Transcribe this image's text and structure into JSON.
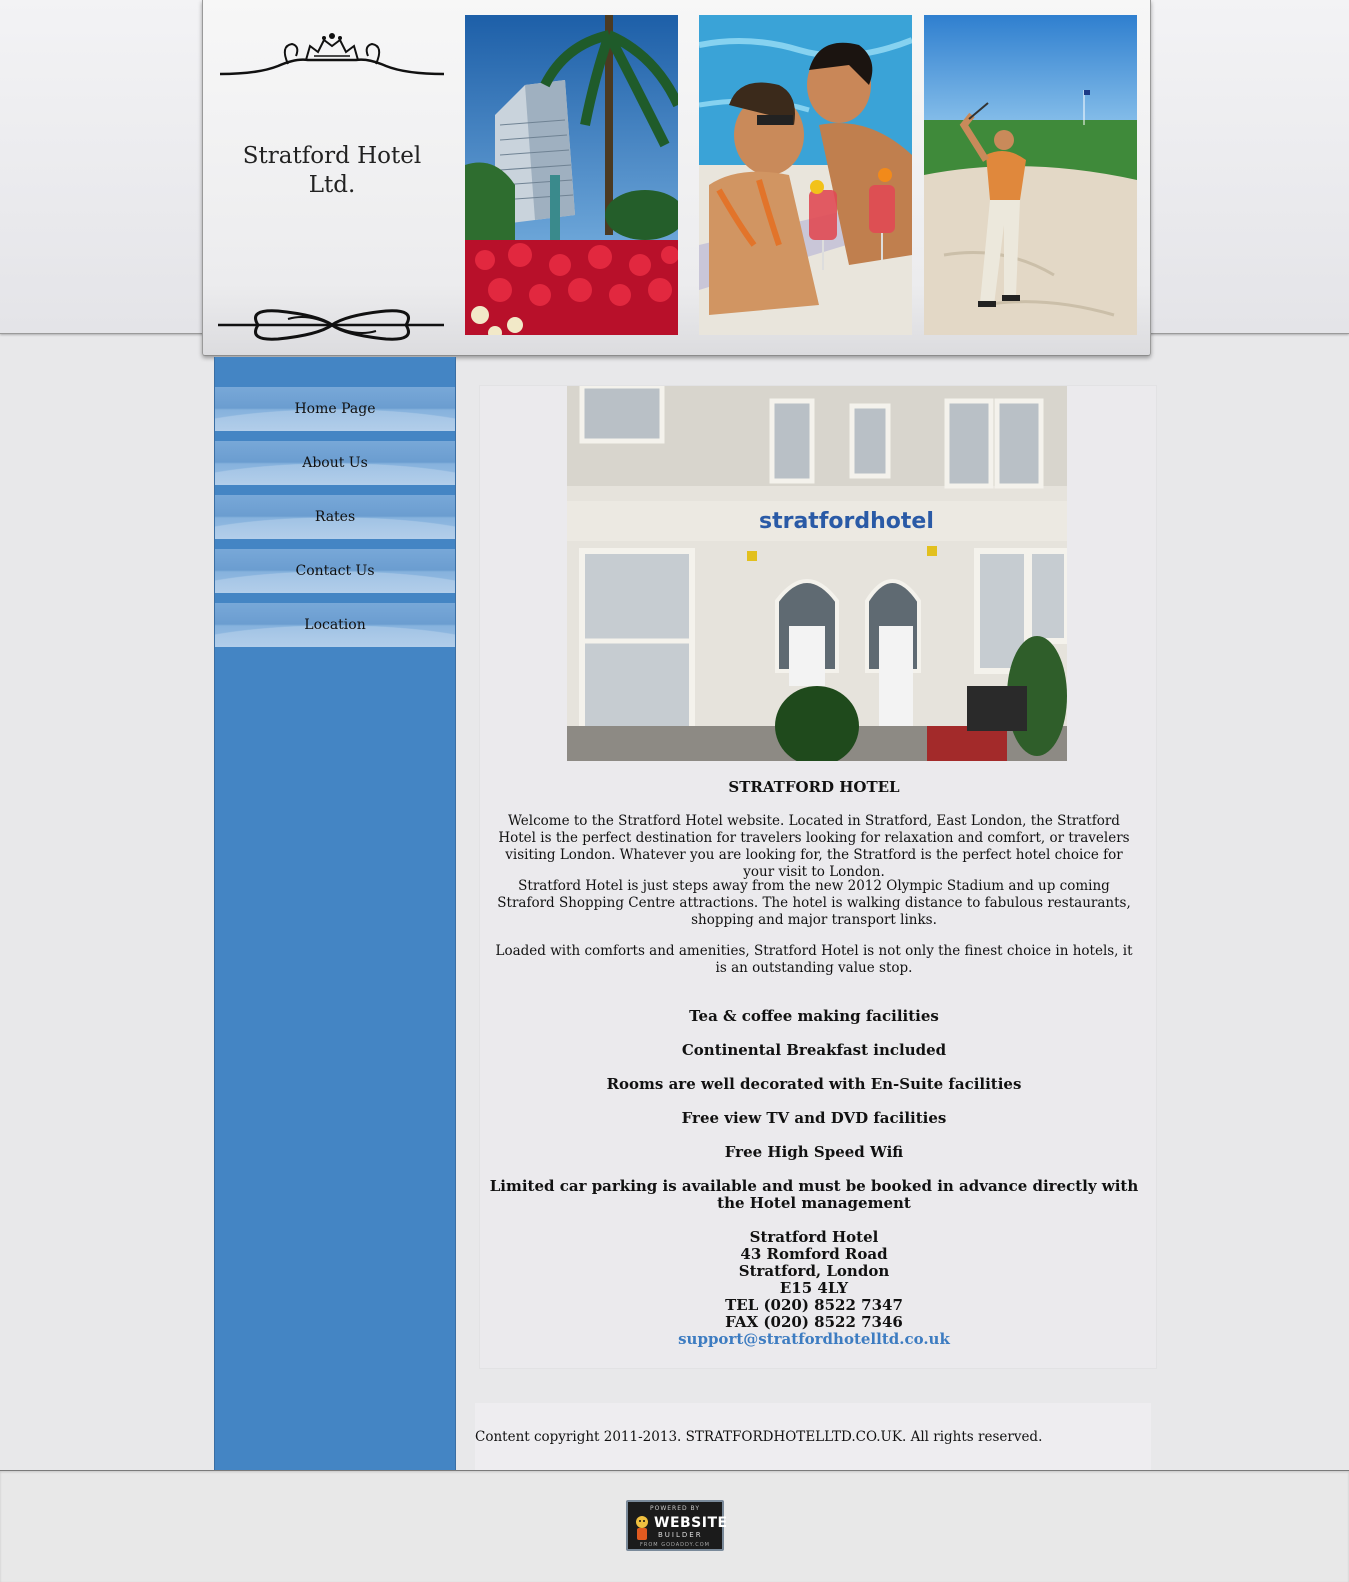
{
  "site": {
    "title": "Stratford Hotel Ltd."
  },
  "header": {
    "photos": [
      "hotel-tower-photo",
      "pool-couple-photo",
      "golfer-photo"
    ]
  },
  "nav": {
    "items": [
      {
        "label": "Home Page"
      },
      {
        "label": "About Us"
      },
      {
        "label": "Rates"
      },
      {
        "label": "Contact Us"
      },
      {
        "label": "Location"
      }
    ]
  },
  "main": {
    "photo_sign": "stratfordhotel",
    "heading": "STRATFORD HOTEL",
    "paragraphs": [
      "Welcome to the Stratford Hotel website. Located in Stratford, East London, the Stratford Hotel is the perfect destination for travelers looking for relaxation and comfort, or travelers visiting London. Whatever you are looking for, the Stratford is the perfect hotel choice for your visit to London.",
      "Stratford Hotel is just steps away from the new 2012 Olympic Stadium and up coming Straford Shopping Centre attractions. The hotel is walking distance to fabulous restaurants, shopping and major transport links.",
      "Loaded with comforts and amenities, Stratford Hotel is not only the finest choice in hotels, it is an outstanding value stop."
    ],
    "features": [
      "Tea & coffee making facilities",
      "Continental Breakfast included",
      "Rooms are well decorated with En-Suite facilities",
      "Free view TV and DVD facilities",
      "Free High Speed Wifi",
      "Limited car parking is available and must be booked in advance directly with the Hotel management"
    ],
    "address": {
      "name": "Stratford Hotel",
      "street": "43 Romford Road",
      "city": "Stratford, London",
      "postcode": "E15 4LY",
      "tel": "TEL (020) 8522 7347",
      "fax": "FAX (020) 8522 7346",
      "email": "support@stratfordhotelltd.co.uk"
    }
  },
  "footer": {
    "copyright": "Content copyright 2011-2013. STRATFORDHOTELLTD.CO.UK. All rights reserved.",
    "badge": {
      "top": "POWERED BY",
      "main": "WEBSITE",
      "sub": "BUILDER",
      "from": "FROM GODADDY.COM"
    }
  },
  "colors": {
    "sidebar": "#4485c4",
    "link": "#3d7cc1",
    "background": "#e8e8ea"
  }
}
